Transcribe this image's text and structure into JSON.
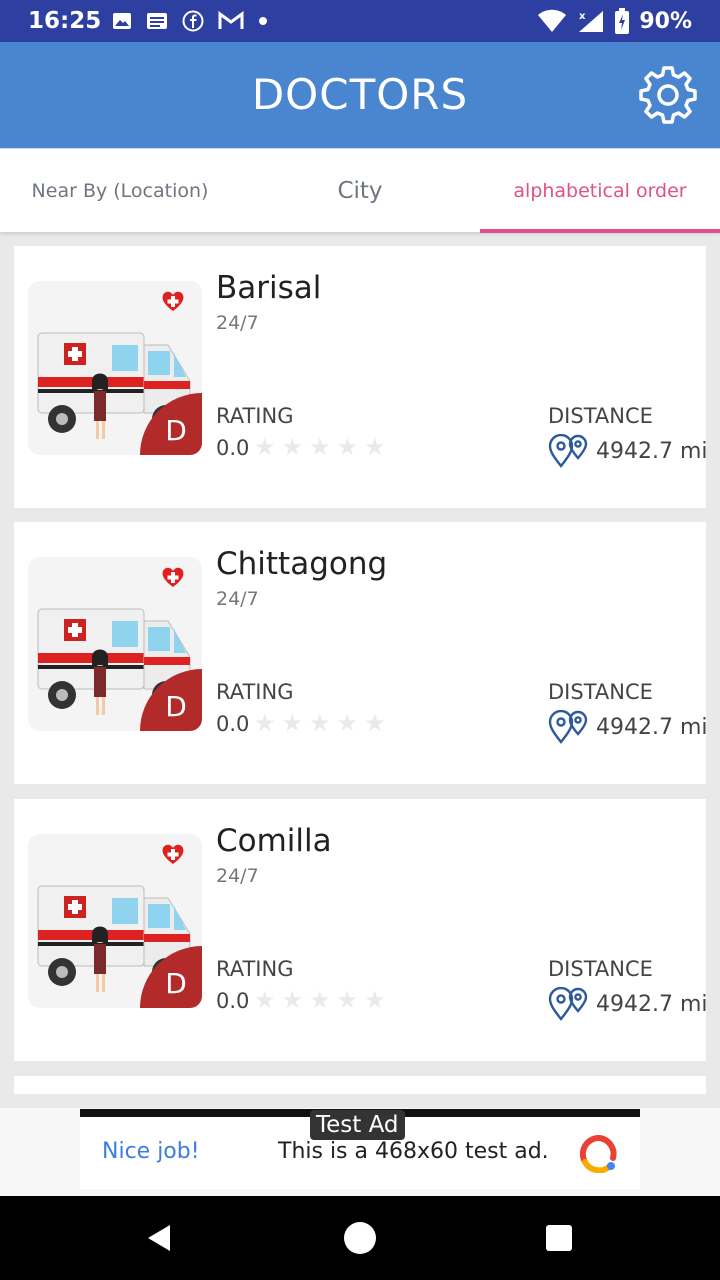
{
  "status_bar": {
    "time": "16:25",
    "battery": "90%"
  },
  "appbar": {
    "title": "DOCTORS",
    "settings_icon": "gear-icon"
  },
  "tabs": [
    {
      "label": "Near By (Location)",
      "active": false
    },
    {
      "label": "City",
      "active": false
    },
    {
      "label": "alphabetical order",
      "active": true
    }
  ],
  "cards": [
    {
      "title": "Barisal",
      "hours": "24/7",
      "rating_label": "RATING",
      "rating": "0.0",
      "stars": 5,
      "distance_label": "DISTANCE",
      "distance": "4942.7 mi",
      "badge": "D"
    },
    {
      "title": "Chittagong",
      "hours": "24/7",
      "rating_label": "RATING",
      "rating": "0.0",
      "stars": 5,
      "distance_label": "DISTANCE",
      "distance": "4942.7 mi",
      "badge": "D"
    },
    {
      "title": "Comilla",
      "hours": "24/7",
      "rating_label": "RATING",
      "rating": "0.0",
      "stars": 5,
      "distance_label": "DISTANCE",
      "distance": "4942.7 mi",
      "badge": "D"
    }
  ],
  "ad": {
    "label": "Test Ad",
    "nice": "Nice job!",
    "text": "This is a 468x60 test ad."
  },
  "colors": {
    "status_bar": "#2d3fa0",
    "appbar": "#4a86cf",
    "active_tab": "#e0508a",
    "badge": "#b32a2a"
  }
}
